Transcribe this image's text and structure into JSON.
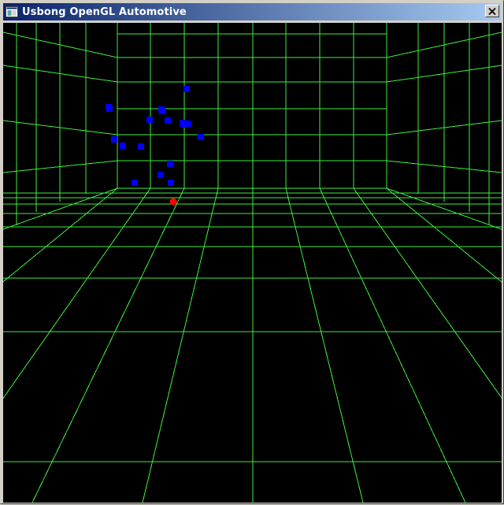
{
  "window": {
    "title": "Usbong OpenGL Automotive"
  },
  "colors": {
    "grid": "#3cf03c",
    "blue_marker": "#0000ff",
    "red_marker": "#ff0000",
    "background": "#000000",
    "titlebar_start": "#0a246a",
    "titlebar_end": "#a6caf0"
  },
  "icons": {
    "app": "window-app-icon",
    "close": "close-icon"
  },
  "scene": {
    "blue_marker_count": 18,
    "red_marker_count": 1
  }
}
